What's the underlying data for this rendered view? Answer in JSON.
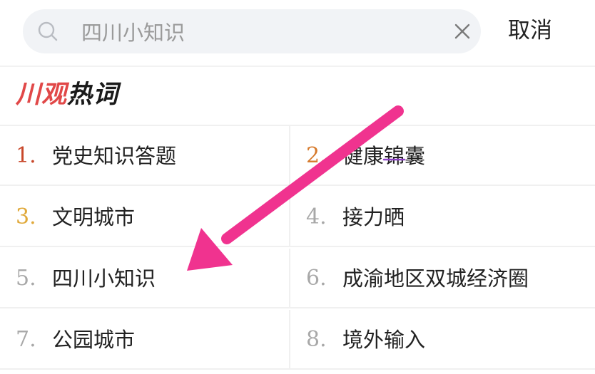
{
  "search": {
    "query": "四川小知识",
    "placeholder": "四川小知识",
    "cancel_label": "取消",
    "search_icon": "search-icon",
    "clear_icon": "close-icon"
  },
  "hot_words": {
    "title_accent": "川观",
    "title_rest": "热词",
    "accent_color": "#e14848",
    "items": [
      {
        "rank": "1.",
        "label": "党史知识答题",
        "rank_color": "#c8472a"
      },
      {
        "rank": "2.",
        "label": "健康锦囊",
        "rank_color": "#d67a2c"
      },
      {
        "rank": "3.",
        "label": "文明城市",
        "rank_color": "#e0a93a"
      },
      {
        "rank": "4.",
        "label": "接力晒",
        "rank_color": "#a8a8a8"
      },
      {
        "rank": "5.",
        "label": "四川小知识",
        "rank_color": "#a8a8a8"
      },
      {
        "rank": "6.",
        "label": "成渝地区双城经济圈",
        "rank_color": "#a8a8a8"
      },
      {
        "rank": "7.",
        "label": "公园城市",
        "rank_color": "#a8a8a8"
      },
      {
        "rank": "8.",
        "label": "境外输入",
        "rank_color": "#a8a8a8"
      }
    ]
  },
  "annotation": {
    "arrow_color": "#f0338f"
  }
}
